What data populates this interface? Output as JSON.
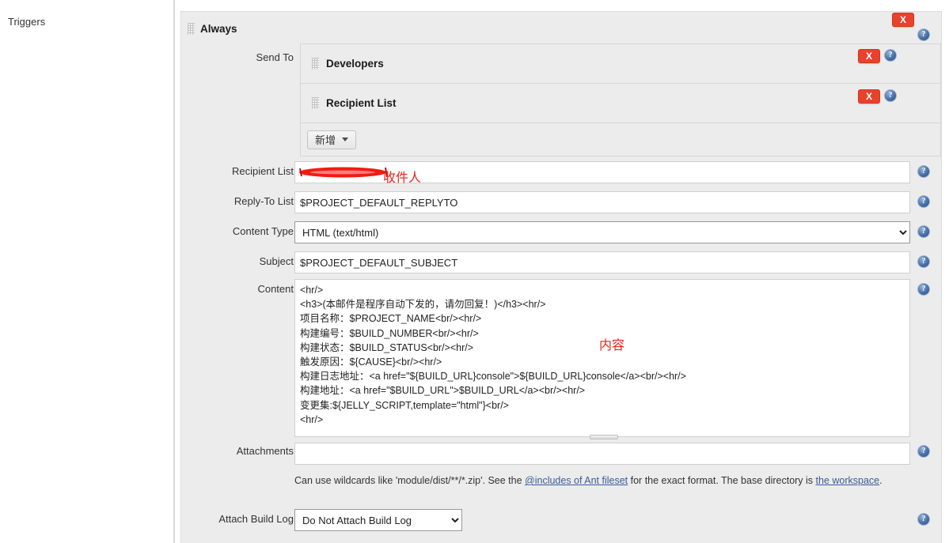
{
  "sidebar": {
    "items": [
      {
        "label": "Triggers"
      }
    ]
  },
  "trigger": {
    "title": "Always",
    "grip_icon": "drag-handle-icon",
    "close_label": "X"
  },
  "send_to": {
    "label": "Send To",
    "items": [
      {
        "label": "Developers",
        "close_label": "X"
      },
      {
        "label": "Recipient List",
        "close_label": "X"
      }
    ],
    "add_button": "新增"
  },
  "fields": {
    "recipient_list": {
      "label": "Recipient List",
      "value": "",
      "annotation": "收件人",
      "redacted": true
    },
    "reply_to_list": {
      "label": "Reply-To List",
      "value": "$PROJECT_DEFAULT_REPLYTO"
    },
    "content_type": {
      "label": "Content Type",
      "value": "HTML (text/html)",
      "options": [
        "HTML (text/html)"
      ]
    },
    "subject": {
      "label": "Subject",
      "value": "$PROJECT_DEFAULT_SUBJECT"
    },
    "content": {
      "label": "Content",
      "annotation": "内容",
      "value": "<hr/>\n<h3>(本邮件是程序自动下发的，请勿回复！)</h3><hr/>\n项目名称：$PROJECT_NAME<br/><hr/>\n构建编号：$BUILD_NUMBER<br/><hr/>\n构建状态：$BUILD_STATUS<br/><hr/>\n触发原因：${CAUSE}<br/><hr/>\n构建日志地址：<a href=\"${BUILD_URL}console\">${BUILD_URL}console</a><br/><hr/>\n构建地址：<a href=\"$BUILD_URL\">$BUILD_URL</a><br/><hr/>\n变更集:${JELLY_SCRIPT,template=\"html\"}<br/>\n<hr/>"
    },
    "attachments": {
      "label": "Attachments",
      "value": "",
      "help_pre": "Can use wildcards like 'module/dist/**/*.zip'. See the ",
      "help_link1": "@includes of Ant fileset",
      "help_mid": " for the exact format. The base directory is ",
      "help_link2": "the workspace",
      "help_end": "."
    },
    "attach_build_log": {
      "label": "Attach Build Log",
      "value": "Do Not Attach Build Log",
      "options": [
        "Do Not Attach Build Log"
      ]
    }
  },
  "help_icons": {
    "name": "help-icon",
    "glyph": "?"
  },
  "colors": {
    "panel_bg": "#ececec",
    "danger": "#e8412c",
    "annotation": "#e8231b",
    "link": "#3a5a9a"
  }
}
